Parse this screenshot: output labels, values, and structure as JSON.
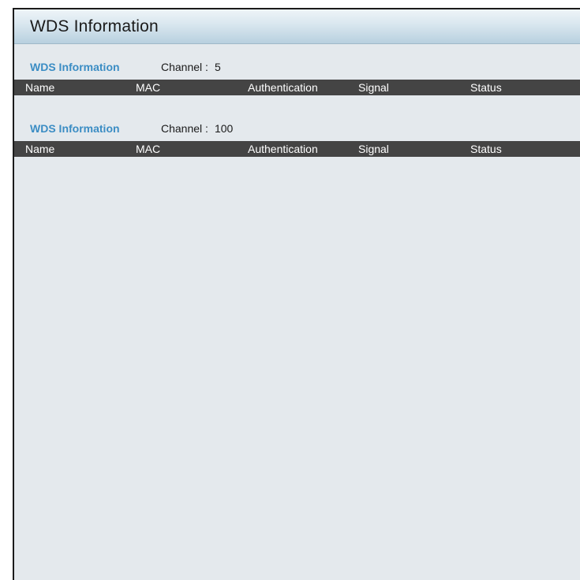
{
  "panel": {
    "title": "WDS Information"
  },
  "sections": [
    {
      "label": "WDS Information",
      "channel_label": "Channel :",
      "channel_value": "5",
      "columns": [
        "Name",
        "MAC",
        "Authentication",
        "Signal",
        "Status"
      ]
    },
    {
      "label": "WDS Information",
      "channel_label": "Channel :",
      "channel_value": "100",
      "columns": [
        "Name",
        "MAC",
        "Authentication",
        "Signal",
        "Status"
      ]
    }
  ]
}
